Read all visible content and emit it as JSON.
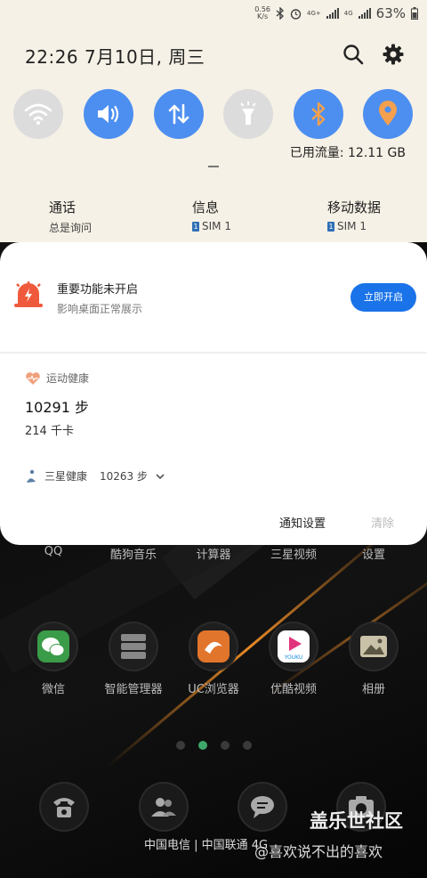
{
  "status_bar": {
    "speed_value": "0.56",
    "speed_unit": "K/s",
    "net1": "4G+",
    "net2": "4G",
    "battery": "63%"
  },
  "header": {
    "time_date": "22:26 7月10日, 周三",
    "icons": [
      "search-icon",
      "gear-icon"
    ]
  },
  "quick_settings": [
    {
      "name": "wifi",
      "icon": "wifi-icon",
      "on": false
    },
    {
      "name": "sound",
      "icon": "speaker-icon",
      "on": true
    },
    {
      "name": "mobile-data",
      "icon": "data-arrows-icon",
      "on": true
    },
    {
      "name": "flashlight",
      "icon": "flashlight-icon",
      "on": false
    },
    {
      "name": "bluetooth",
      "icon": "bluetooth-icon",
      "on": true
    },
    {
      "name": "location",
      "icon": "location-icon",
      "on": true
    }
  ],
  "data_usage": "已用流量: 12.11 GB",
  "sim_settings": [
    {
      "title": "通话",
      "sub": "总是询问",
      "badge": ""
    },
    {
      "title": "信息",
      "sub": "SIM 1",
      "badge": "1"
    },
    {
      "title": "移动数据",
      "sub": "SIM 1",
      "badge": "1"
    }
  ],
  "notification": {
    "title": "重要功能未开启",
    "subtitle": "影响桌面正常展示",
    "button": "立即开启"
  },
  "health": {
    "header": "运动健康",
    "steps": "10291 步",
    "kcal": "214 千卡",
    "samsung_label": "三星健康",
    "samsung_steps": "10263 步"
  },
  "card_footer": {
    "settings": "通知设置",
    "clear": "清除"
  },
  "home": {
    "row1": [
      "QQ",
      "酷狗音乐",
      "计算器",
      "三星视频",
      "设置"
    ],
    "row2": [
      "微信",
      "智能管理器",
      "UC浏览器",
      "优酷视频",
      "相册"
    ],
    "row2_badge": "YOUKU",
    "carrier": "中国电信 | 中国联通 4G"
  },
  "watermark": {
    "main": "盖乐世社区",
    "sub": "@喜欢说不出的喜欢"
  },
  "colors": {
    "accent": "#4d8ff0",
    "button": "#1a73e8",
    "alert": "#f05a3c",
    "panel_bg": "#f6f1e6"
  }
}
